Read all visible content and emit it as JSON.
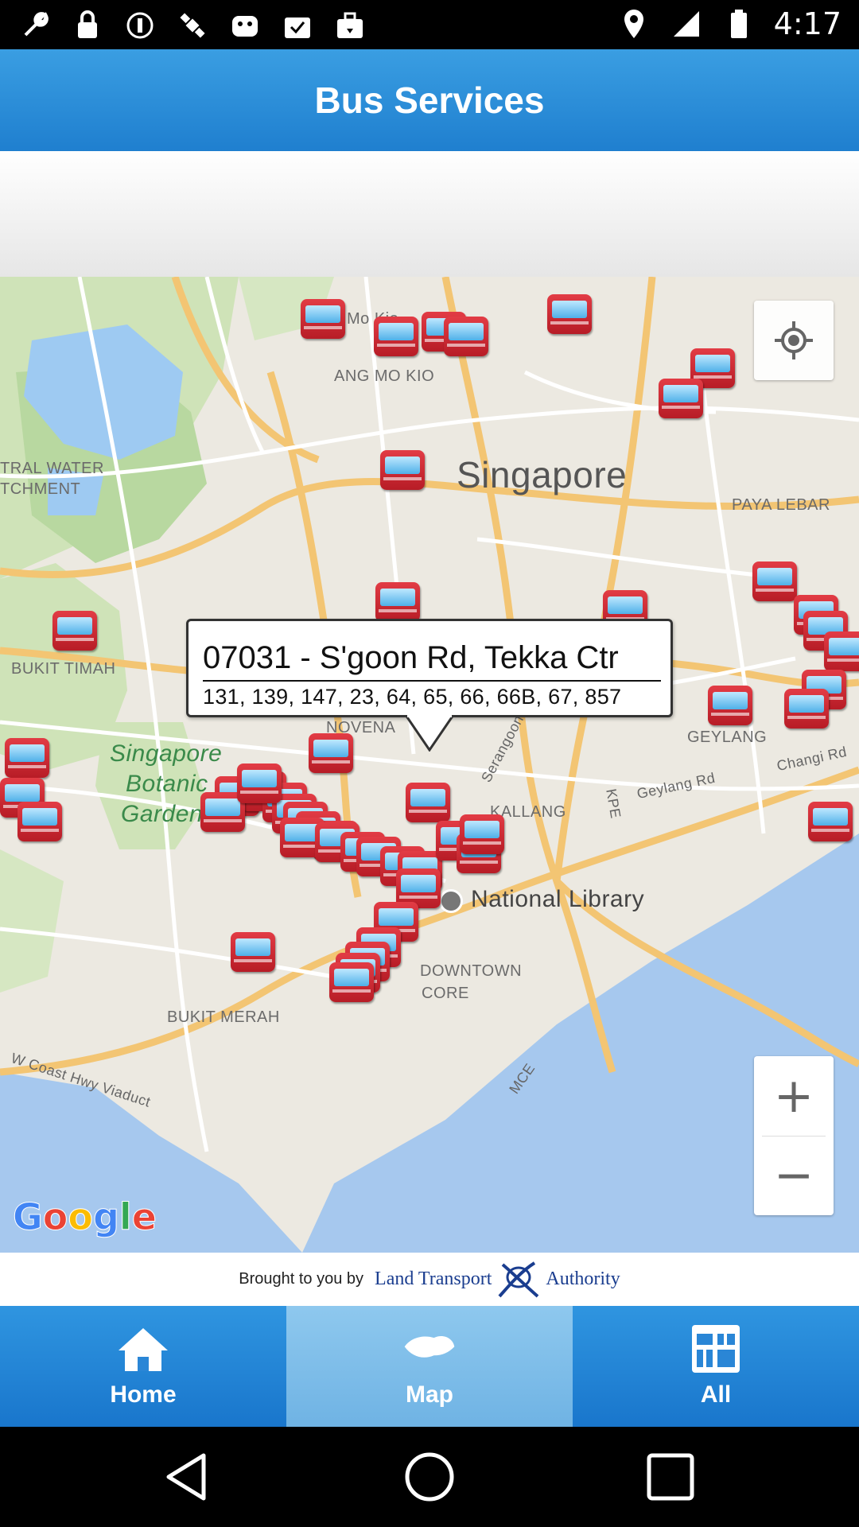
{
  "status_bar": {
    "time": "4:17",
    "left_icons": [
      "wrench-icon",
      "lock-icon",
      "info-icon",
      "satellite-icon",
      "keyboard-icon",
      "check-bag-icon",
      "briefcase-icon"
    ],
    "right_icons": [
      "location-pin-icon",
      "signal-icon",
      "battery-icon"
    ]
  },
  "header": {
    "title": "Bus Services"
  },
  "map": {
    "labels": {
      "mo_kio": "Mo Kio",
      "ang_mo_kio": "ANG MO KIO",
      "singapore": "Singapore",
      "paya_lebar": "PAYA LEBAR",
      "tral_water": "TRAL WATER",
      "tchment": "TCHMENT",
      "bukit_timah": "BUKIT TIMAH",
      "novena": "NOVENA",
      "geylang": "GEYLANG",
      "changi_rd": "Changi Rd",
      "geylang_rd": "Geylang Rd",
      "serangoon_rd": "Serangoon Rd",
      "kpe": "KPE",
      "kallang": "KALLANG",
      "botanic_1": "Singapore",
      "botanic_2": "Botanic",
      "botanic_3": "Garden",
      "national_library": "National Library",
      "downtown": "DOWNTOWN",
      "core": "CORE",
      "bukit_merah": "BUKIT MERAH",
      "w_coast": "W Coast Hwy Viaduct",
      "mce": "MCE",
      "google": "Google"
    },
    "callout": {
      "title": "07031 - S'goon Rd, Tekka Ctr",
      "services": "131, 139, 147, 23, 64, 65, 66, 66B, 67, 857"
    },
    "zoom_in": "+",
    "zoom_out": "−"
  },
  "attribution": {
    "by": "Brought to you by",
    "lta_left": "Land Transport",
    "lta_right": "Authority"
  },
  "tabs": [
    {
      "label": "Home",
      "icon": "home-icon"
    },
    {
      "label": "Map",
      "icon": "map-icon"
    },
    {
      "label": "All",
      "icon": "grid-icon"
    }
  ],
  "colors": {
    "header_blue": "#1f7fcf",
    "active_tab": "#8ec8ee",
    "bus_red": "#d32f2f"
  }
}
